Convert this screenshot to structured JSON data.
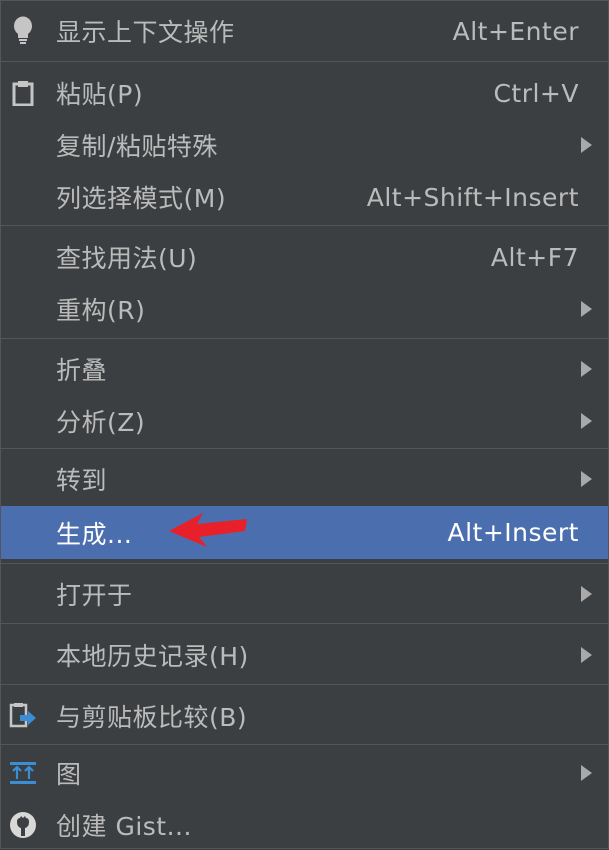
{
  "menu": {
    "items": [
      {
        "label": "显示上下文操作",
        "shortcut": "Alt+Enter",
        "icon": "lightbulb-icon"
      },
      {
        "label": "粘贴(P)",
        "shortcut": "Ctrl+V",
        "icon": "clipboard-icon"
      },
      {
        "label": "复制/粘贴特殊",
        "submenu": true
      },
      {
        "label": "列选择模式(M)",
        "shortcut": "Alt+Shift+Insert"
      },
      {
        "label": "查找用法(U)",
        "shortcut": "Alt+F7"
      },
      {
        "label": "重构(R)",
        "submenu": true
      },
      {
        "label": "折叠",
        "submenu": true
      },
      {
        "label": "分析(Z)",
        "submenu": true
      },
      {
        "label": "转到",
        "submenu": true
      },
      {
        "label": "生成...",
        "shortcut": "Alt+Insert",
        "selected": true
      },
      {
        "label": "打开于",
        "submenu": true
      },
      {
        "label": "本地历史记录(H)",
        "submenu": true
      },
      {
        "label": "与剪贴板比较(B)",
        "icon": "compare-clipboard-icon"
      },
      {
        "label": "图",
        "submenu": true,
        "icon": "diagram-icon"
      },
      {
        "label": "创建 Gist...",
        "icon": "github-icon"
      }
    ]
  },
  "colors": {
    "background": "#3c3f41",
    "selected": "#4b6eaf",
    "text": "#bbbbbb",
    "annotation_arrow": "#e8202a"
  }
}
